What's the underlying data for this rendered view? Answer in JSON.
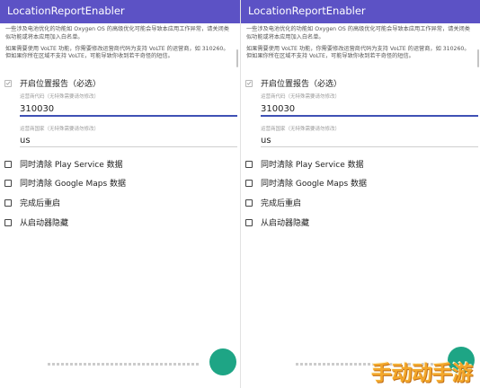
{
  "app": {
    "title": "LocationReportEnabler"
  },
  "description": {
    "para1": "一些涉及电池优化的功能如 Oxygen OS 的高级优化可能会导致本应用工作异常，请关闭类似功能或将本应用加入白名单。",
    "para2": "如果需要使用 VoLTE 功能，你需要修改运营商代码为支持 VoLTE 的运营商，如 310260。但如果你所在区域不支持 VoLTE，可能导致你收到若干奇怪的短信。"
  },
  "form": {
    "enable_report": {
      "label": "开启位置报告（必选）",
      "checked": true
    },
    "carrier_code": {
      "hint": "运营商代码（无特殊需要请勿修改）",
      "value": "310030"
    },
    "carrier_country": {
      "hint": "运营商国家（无特殊需要请勿修改）",
      "value": "us"
    },
    "clear_play_service": {
      "label": "同时清除 Play Service 数据",
      "checked": false
    },
    "clear_google_maps": {
      "label": "同时清除 Google Maps 数据",
      "checked": false
    },
    "reboot_after": {
      "label": "完成后重启",
      "checked": false
    },
    "hide_launcher": {
      "label": "从启动器隐藏",
      "checked": false
    }
  },
  "icons": {
    "checkmark": "check-icon",
    "fab": "fab-button"
  },
  "colors": {
    "titlebar": "#5c52c5",
    "accent": "#3f51b5",
    "fab": "#1ea585",
    "watermark": "#f3a72a"
  },
  "watermark": {
    "text": "手动动手游"
  }
}
